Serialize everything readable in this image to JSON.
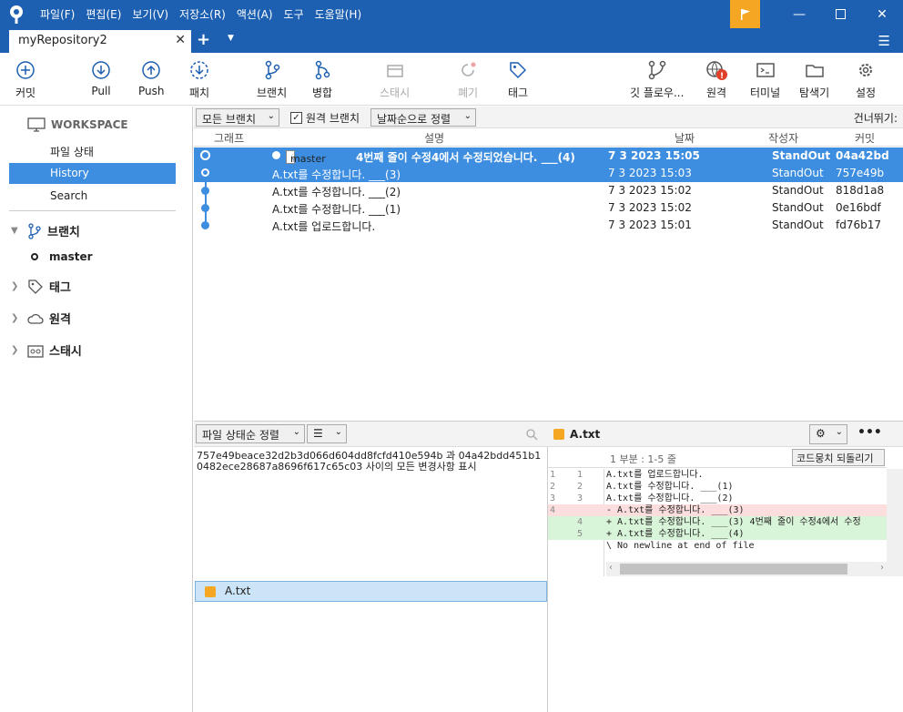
{
  "menu": [
    "파일(F)",
    "편집(E)",
    "보기(V)",
    "저장소(R)",
    "액션(A)",
    "도구",
    "도움말(H)"
  ],
  "tab": {
    "title": "myRepository2"
  },
  "toolbar": {
    "commit": "커밋",
    "pull": "Pull",
    "push": "Push",
    "fetch": "패치",
    "branch": "브랜치",
    "merge": "병합",
    "stash": "스태시",
    "discard": "폐기",
    "tag": "태그",
    "gitflow": "깃 플로우...",
    "remote": "원격",
    "terminal": "터미널",
    "explorer": "탐색기",
    "settings": "설정"
  },
  "sidebar": {
    "workspace": "WORKSPACE",
    "items": [
      "파일 상태",
      "History",
      "Search"
    ],
    "branches": "브랜치",
    "master": "master",
    "tags": "태그",
    "remotes": "원격",
    "stashes": "스태시"
  },
  "filter": {
    "all_branches": "모든 브랜치",
    "remote_branches": "원격 브랜치",
    "sort": "날짜순으로 정렬",
    "skip": "건너뛰기:"
  },
  "history": {
    "columns": [
      "그래프",
      "설명",
      "날짜",
      "작성자",
      "커밋"
    ],
    "rows": [
      {
        "branch": "master",
        "desc": "4번째 줄이 수정4에서 수정되었습니다. ___(4)",
        "date": "7 3 2023 15:05",
        "author": "StandOut",
        "commit": "04a42bd"
      },
      {
        "desc": "A.txt를 수정합니다. ___(3)",
        "date": "7 3 2023 15:03",
        "author": "StandOut",
        "commit": "757e49b"
      },
      {
        "desc": "A.txt를 수정합니다. ___(2)",
        "date": "7 3 2023 15:02",
        "author": "StandOut",
        "commit": "818d1a8"
      },
      {
        "desc": "A.txt를 수정합니다. ___(1)",
        "date": "7 3 2023 15:02",
        "author": "StandOut",
        "commit": "0e16bdf"
      },
      {
        "desc": "A.txt를 업로드합니다.",
        "date": "7 3 2023 15:01",
        "author": "StandOut",
        "commit": "fd76b17"
      }
    ]
  },
  "files": {
    "sort": "파일 상태순 정렬",
    "description": "757e49beace32d2b3d066d604dd8fcfd410e594b 과 04a42bdd451b10482ece28687a8696f617c65c03 사이의 모든 변경사항 표시",
    "file": "A.txt"
  },
  "diff": {
    "file": "A.txt",
    "hunk": "1 부분 : 1-5 줄",
    "revert": "코드뭉치 되돌리기",
    "lines": [
      {
        "n1": "1",
        "n2": "1",
        "text": "  A.txt를 업로드합니다.",
        "type": "ctx"
      },
      {
        "n1": "2",
        "n2": "2",
        "text": "  A.txt를 수정합니다. ___(1)",
        "type": "ctx"
      },
      {
        "n1": "3",
        "n2": "3",
        "text": "  A.txt를 수정합니다. ___(2)",
        "type": "ctx"
      },
      {
        "n1": "4",
        "n2": "",
        "text": "- A.txt를 수정합니다. ___(3)",
        "type": "del"
      },
      {
        "n1": "",
        "n2": "4",
        "text": "+ A.txt를 수정합니다. ___(3) 4번째 줄이 수정4에서 수정",
        "type": "add"
      },
      {
        "n1": "",
        "n2": "5",
        "text": "+ A.txt를 수정합니다. ___(4)",
        "type": "add"
      },
      {
        "n1": "",
        "n2": "",
        "text": "\\ No newline at end of file",
        "type": "ctx"
      }
    ]
  }
}
